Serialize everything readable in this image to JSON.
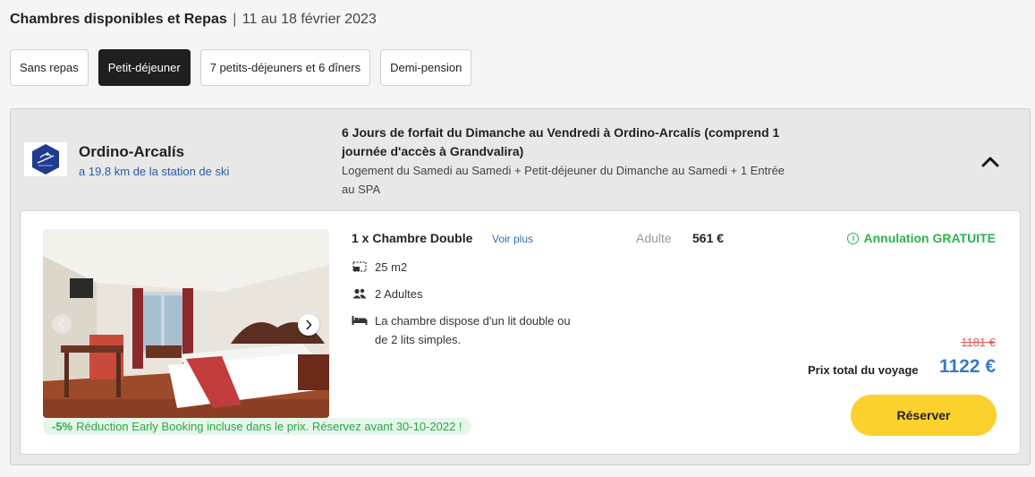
{
  "header": {
    "title": "Chambres disponibles et Repas",
    "separator": "|",
    "dates": "11 au 18 février 2023"
  },
  "tabs": [
    {
      "label": "Sans repas",
      "active": false
    },
    {
      "label": "Petit-déjeuner",
      "active": true
    },
    {
      "label": "7 petits-déjeuners et 6 dîners",
      "active": false
    },
    {
      "label": "Demi-pension",
      "active": false
    }
  ],
  "hotel": {
    "name": "Ordino-Arcalís",
    "distance": "a 19.8 km de la station de ski",
    "logo_icon": "ski-resort-logo"
  },
  "package": {
    "title": "6 Jours de forfait du Dimanche au Vendredi à Ordino-Arcalís (comprend 1 journée d'accès à Grandvalira)",
    "description": "Logement du Samedi au Samedi + Petit-déjeuner du Dimanche au Samedi + 1 Entrée au SPA"
  },
  "room": {
    "title": "1 x Chambre Double",
    "more_link": "Voir plus",
    "features": [
      {
        "icon": "area-icon",
        "text": "25 m2"
      },
      {
        "icon": "people-icon",
        "text": "2 Adultes"
      },
      {
        "icon": "bed-icon",
        "text": "La chambre dispose d'un lit double ou de 2 lits simples."
      }
    ],
    "price_label": "Adulte",
    "price_value": "561 €",
    "cancellation_prefix": "Annulation",
    "cancellation_free": "GRATUITE",
    "old_price": "1181 €",
    "total_label": "Prix total du voyage",
    "total_price": "1122 €",
    "reserve_label": "Réserver",
    "promo_percent": "-5%",
    "promo_text": "Réduction Early Booking incluse dans le prix. Réservez avant 30-10-2022 !"
  },
  "colors": {
    "accent_blue": "#3b7ac4",
    "success_green": "#2bb34d",
    "reserve_yellow": "#fbd12d",
    "strike_red": "#e05a5a"
  }
}
